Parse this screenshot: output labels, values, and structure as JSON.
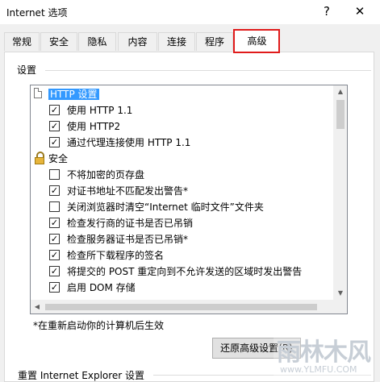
{
  "window": {
    "title": "Internet 选项",
    "help_glyph": "?",
    "close_glyph": "✕"
  },
  "tabs": [
    {
      "label": "常规"
    },
    {
      "label": "安全"
    },
    {
      "label": "隐私"
    },
    {
      "label": "内容"
    },
    {
      "label": "连接"
    },
    {
      "label": "程序"
    },
    {
      "label": "高级",
      "active": true
    }
  ],
  "settings": {
    "group_label": "设置",
    "tree": [
      {
        "type": "category",
        "icon": "page-icon",
        "label": "HTTP 设置",
        "selected": true
      },
      {
        "type": "option",
        "checked": true,
        "label": "使用 HTTP 1.1"
      },
      {
        "type": "option",
        "checked": true,
        "label": "使用 HTTP2"
      },
      {
        "type": "option",
        "checked": true,
        "label": "通过代理连接使用 HTTP 1.1"
      },
      {
        "type": "category",
        "icon": "lock-icon",
        "label": "安全"
      },
      {
        "type": "option",
        "checked": false,
        "label": "不将加密的页存盘"
      },
      {
        "type": "option",
        "checked": true,
        "label": "对证书地址不匹配发出警告*"
      },
      {
        "type": "option",
        "checked": false,
        "label": "关闭浏览器时清空“Internet 临时文件”文件夹"
      },
      {
        "type": "option",
        "checked": true,
        "label": "检查发行商的证书是否已吊销"
      },
      {
        "type": "option",
        "checked": true,
        "label": "检查服务器证书是否已吊销*"
      },
      {
        "type": "option",
        "checked": true,
        "label": "检查所下载程序的签名"
      },
      {
        "type": "option",
        "checked": true,
        "label": "将提交的 POST 重定向到不允许发送的区域时发出警告"
      },
      {
        "type": "option",
        "checked": true,
        "label": "启用 DOM 存储"
      }
    ],
    "restart_note": "*在重新启动你的计算机后生效",
    "restore_button": "还原高级设置(R)"
  },
  "reset": {
    "group_label": "重置 Internet Explorer 设置"
  },
  "watermark": {
    "big": "雨林木风",
    "small": "www.YLMFU.COM"
  },
  "colors": {
    "selection": "#3399ff",
    "tab_highlight": "#e01b1b"
  }
}
